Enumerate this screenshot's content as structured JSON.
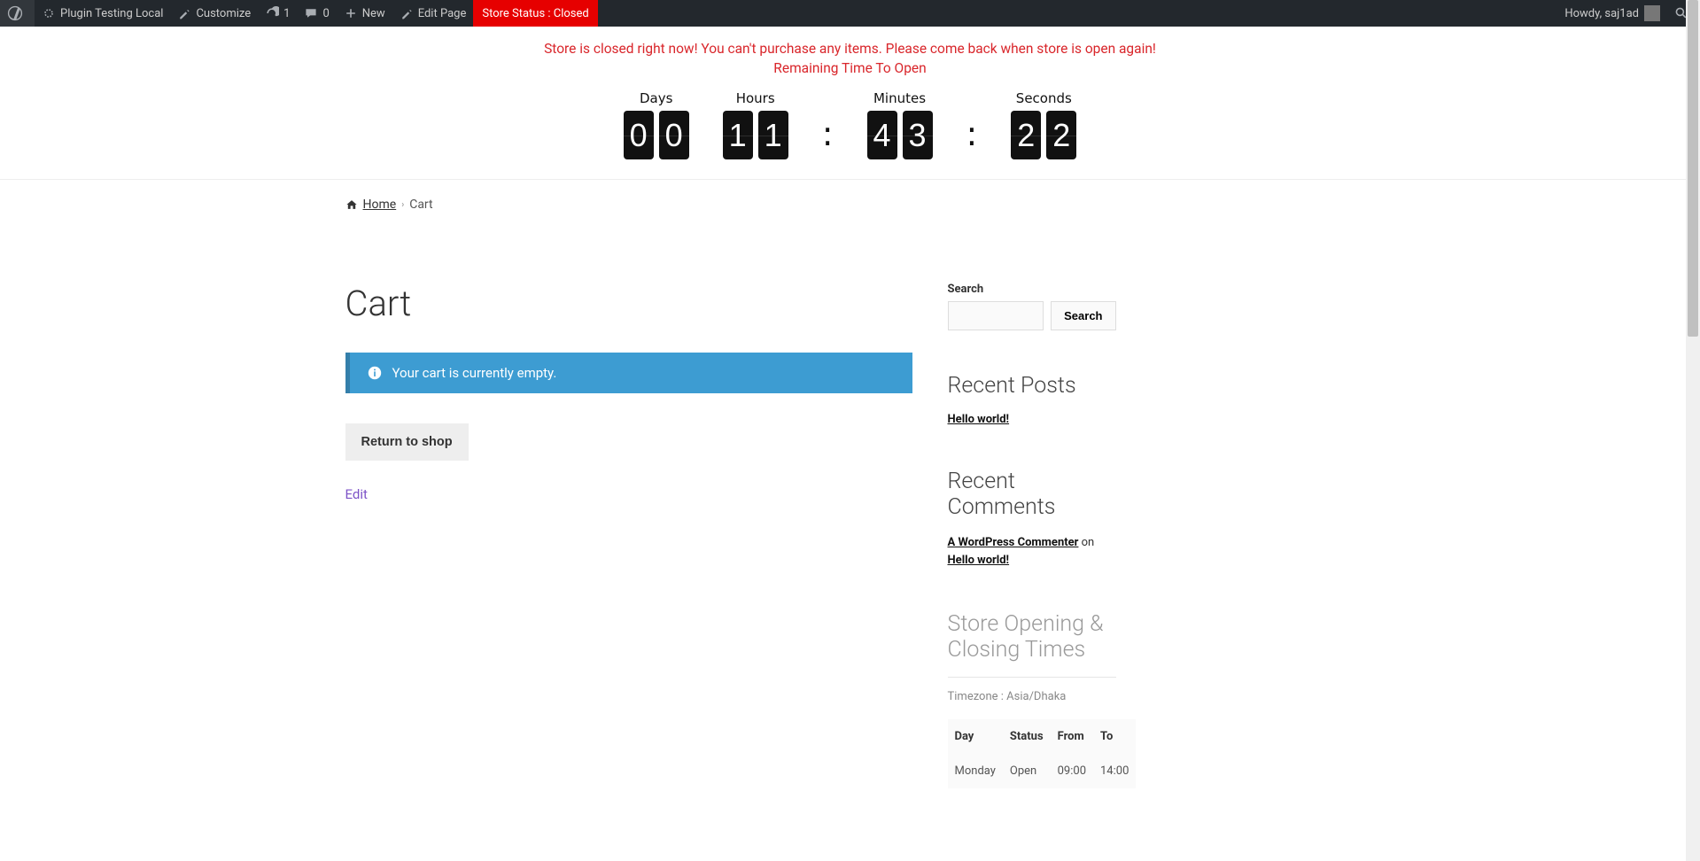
{
  "adminbar": {
    "site_name": "Plugin Testing Local",
    "customize": "Customize",
    "updates": "1",
    "comments": "0",
    "new": "New",
    "edit_page": "Edit Page",
    "store_status": "Store Status : Closed",
    "howdy": "Howdy, saj1ad"
  },
  "notice": {
    "closed_msg": "Store is closed right now! You can't purchase any items. Please come back when store is open again!",
    "remaining": "Remaining Time To Open"
  },
  "countdown": {
    "labels": {
      "days": "Days",
      "hours": "Hours",
      "minutes": "Minutes",
      "seconds": "Seconds"
    },
    "days": "00",
    "hours": "11",
    "minutes": "43",
    "seconds": "22"
  },
  "breadcrumb": {
    "home": "Home",
    "current": "Cart"
  },
  "page": {
    "title": "Cart",
    "empty_msg": "Your cart is currently empty.",
    "return_btn": "Return to shop",
    "edit": "Edit"
  },
  "sidebar": {
    "search_label": "Search",
    "search_btn": "Search",
    "recent_posts_title": "Recent Posts",
    "recent_posts": [
      "Hello world!"
    ],
    "recent_comments_title": "Recent Comments",
    "commenter": "A WordPress Commenter",
    "on": " on ",
    "comment_post": "Hello world!",
    "hours_title": "Store Opening & Closing Times",
    "timezone": "Timezone : Asia/Dhaka",
    "hours_header": {
      "day": "Day",
      "status": "Status",
      "from": "From",
      "to": "To"
    },
    "hours_rows": [
      {
        "day": "Monday",
        "status": "Open",
        "from": "09:00",
        "to": "14:00"
      }
    ]
  }
}
